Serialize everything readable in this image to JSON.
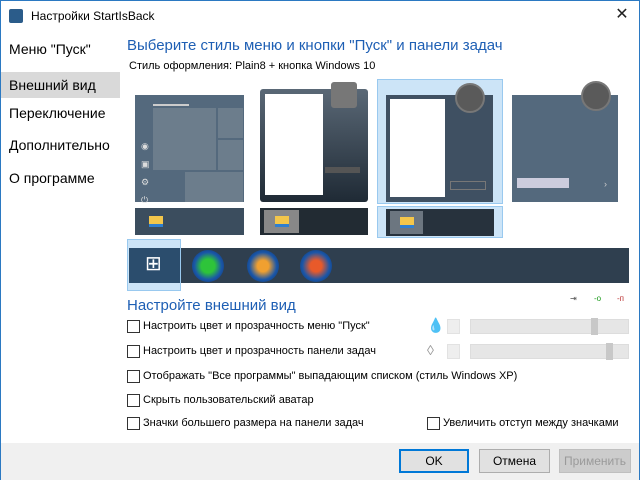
{
  "window": {
    "title": "Настройки StartIsBack",
    "close_icon": "close-icon"
  },
  "sidebar": {
    "items": [
      {
        "label": "Меню \"Пуск\"",
        "selected": false
      },
      {
        "label": "Внешний вид",
        "selected": true
      },
      {
        "label": "Переключение",
        "selected": false
      },
      {
        "label": "Дополнительно",
        "selected": false
      },
      {
        "label": "О программе",
        "selected": false
      }
    ]
  },
  "main": {
    "style_heading": "Выберите стиль меню и кнопки \"Пуск\" и панели задач",
    "style_label": "Стиль оформления:  Plain8 + кнопка Windows 10",
    "selected_start_style": 3,
    "selected_taskbar_style": 3,
    "selected_orb": 1,
    "orbs": [
      "windows-10-logo",
      "clover-orb",
      "windows-7-orb",
      "windows-flag-orb"
    ],
    "appearance_heading": "Настройте внешний вид",
    "legend_icons": [
      "arrow-icon",
      "green-pin-icon",
      "red-pin-icon"
    ],
    "options": [
      {
        "label": "Настроить цвет и прозрачность меню \"Пуск\"",
        "checked": false,
        "transparency": 0.8
      },
      {
        "label": "Настроить цвет и прозрачность панели задач",
        "checked": false,
        "transparency": 0.9
      },
      {
        "label": "Отображать \"Все программы\" выпадающим списком (стиль Windows XP)",
        "checked": false
      },
      {
        "label": "Скрыть пользовательский аватар",
        "checked": false
      },
      {
        "label": "Значки большего размера на панели задач",
        "checked": false
      },
      {
        "label": "Увеличить отступ между значками",
        "checked": false
      }
    ]
  },
  "footer": {
    "ok": "OK",
    "cancel": "Отмена",
    "apply": "Применить",
    "apply_enabled": false
  },
  "colors": {
    "accent": "#1e5fb4",
    "selection": "#cce4f7",
    "preview": "#54697d"
  }
}
